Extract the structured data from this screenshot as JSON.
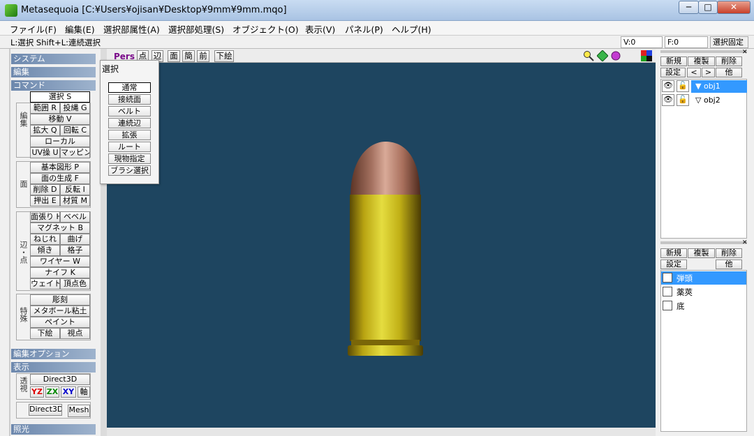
{
  "window": {
    "title": "Metasequoia [C:¥Users¥ojisan¥Desktop¥9mm¥9mm.mqo]",
    "min": "─",
    "max": "□",
    "close": "✕"
  },
  "menu": [
    "ファイル(F)",
    "編集(E)",
    "選択部属性(A)",
    "選択部処理(S)",
    "オブジェクト(O)",
    "表示(V)",
    "パネル(P)",
    "ヘルプ(H)"
  ],
  "status": {
    "hint": "L:選択  Shift+L:連続選択",
    "v": "V:0",
    "f": "F:0",
    "lock": "選択固定"
  },
  "left": {
    "cats": [
      "システム",
      "編集",
      "コマンド",
      "編集オプション",
      "表示",
      "照光"
    ],
    "select": "選択 S",
    "edit_label": "編集",
    "edit": [
      [
        "範囲 R",
        "投縄 G"
      ],
      [
        "移動 V"
      ],
      [
        "拡大 Q",
        "回転 C"
      ],
      [
        "ローカル"
      ],
      [
        "UV操 U",
        "マッピング"
      ]
    ],
    "face_label": "面",
    "face": [
      [
        "基本図形 P"
      ],
      [
        "面の生成 F"
      ],
      [
        "削除 D",
        "反転 I"
      ],
      [
        "押出 E",
        "材質 M"
      ]
    ],
    "edge_label": "辺・点",
    "edge": [
      [
        "面張り H",
        "ベベル"
      ],
      [
        "マグネット B"
      ],
      [
        "ねじれ",
        "曲げ"
      ],
      [
        "傾き",
        "格子"
      ],
      [
        "ワイヤー W"
      ],
      [
        "ナイフ K"
      ],
      [
        "ウェイト",
        "頂点色"
      ]
    ],
    "special_label": "特殊",
    "special": [
      [
        "彫刻"
      ],
      [
        "メタボール粘土"
      ],
      [
        "ペイント"
      ],
      [
        "下絵",
        "視点"
      ]
    ],
    "view_label": "透視",
    "direct3d": "Direct3D",
    "axes": [
      "YZ",
      "ZX",
      "XY",
      "軸"
    ],
    "direct3d2": "Direct3D",
    "mesh": "Mesh"
  },
  "viewtoolbar": {
    "pers": "Pers",
    "buttons": [
      "点",
      "辺",
      "面",
      "簡",
      "前",
      "下絵"
    ]
  },
  "popup": {
    "title": "選択",
    "items": [
      "通常",
      "接続面",
      "ベルト",
      "連続辺",
      "拡張",
      "ルート",
      "現物指定",
      "ブラシ選択"
    ]
  },
  "objpanel": {
    "new": "新規",
    "dup": "複製",
    "del": "削除",
    "set": "設定",
    "prev": "<",
    "next": ">",
    "other": "他",
    "objects": [
      "obj1",
      "obj2"
    ]
  },
  "matpanel": {
    "new": "新規",
    "dup": "複製",
    "del": "削除",
    "set": "設定",
    "other": "他",
    "materials": [
      "弾頭",
      "薬莢",
      "底"
    ]
  },
  "colors": {
    "viewport": "#1e4560",
    "selection": "#3399ff",
    "brass": "#c8b418",
    "copper": "#b97a66"
  }
}
